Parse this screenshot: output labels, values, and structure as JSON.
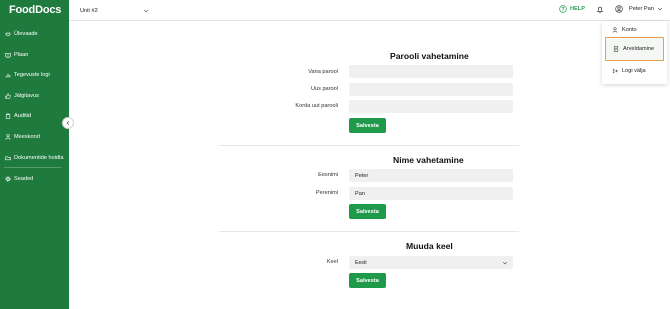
{
  "brand": {
    "logo_text": "FoodDocs"
  },
  "sidebar": {
    "items": [
      {
        "label": "Ülevaade",
        "icon": "handshake-icon"
      },
      {
        "label": "Plaan",
        "icon": "book-icon"
      },
      {
        "label": "Tegevuste logi",
        "icon": "chart-icon"
      },
      {
        "label": "Jälgitavus",
        "icon": "thumbs-icon"
      },
      {
        "label": "Auditid",
        "icon": "clipboard-icon"
      },
      {
        "label": "Meeskond",
        "icon": "person-icon"
      },
      {
        "label": "Dokumentide hoidla",
        "icon": "folder-icon"
      },
      {
        "label": "Seaded",
        "icon": "gear-icon"
      }
    ]
  },
  "topbar": {
    "unit_label": "Unit #2",
    "help_label": "HELP",
    "user_name": "Peter Pan"
  },
  "user_menu": {
    "items": [
      {
        "label": "Konto",
        "icon": "person-icon"
      },
      {
        "label": "Arveldamine",
        "icon": "document-icon"
      },
      {
        "label": "Logi välja",
        "icon": "logout-icon"
      }
    ]
  },
  "password_section": {
    "title": "Parooli vahetamine",
    "old_label": "Vana parool",
    "new_label": "Uus parool",
    "repeat_label": "Korda uut parooli",
    "save_label": "Salvesta"
  },
  "name_section": {
    "title": "Nime vahetamine",
    "first_label": "Eesnimi",
    "first_value": "Peter",
    "last_label": "Perenimi",
    "last_value": "Pan",
    "save_label": "Salvesta"
  },
  "language_section": {
    "title": "Muuda keel",
    "language_label": "Keel",
    "language_value": "Eesti",
    "save_label": "Salvesta"
  },
  "colors": {
    "sidebar": "#1e7a3d",
    "accent": "#1f9a4a",
    "highlight": "#e8a04a"
  }
}
